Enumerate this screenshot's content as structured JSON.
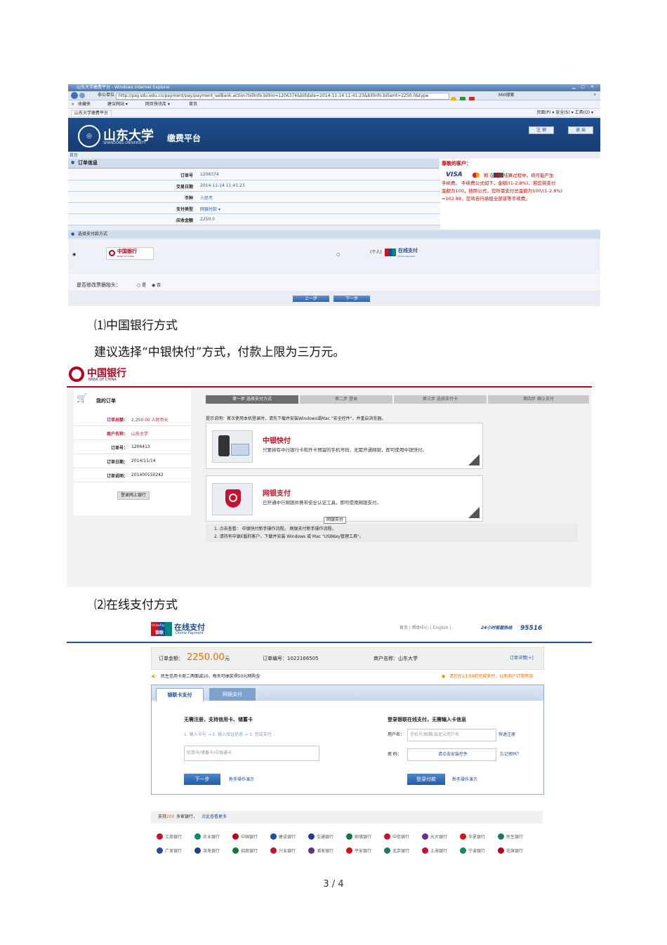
{
  "shot1": {
    "ie_title": "山东大学缴费平台 - Windows Internet Explorer",
    "url": "http://pay.sdu.edu.cn/payment/pay/payment_selBank.action?billInfo.billno=1206374&billdate=2014-11-14 11:41:23&billInfo.billamt=2250.0&type",
    "fav_label": "收藏夹",
    "fav_items": [
      "建议网站 ▾",
      "网页快讯库 ▾",
      "首页"
    ],
    "tab_label": "山东大学缴费平台",
    "toolbar_right": "页面(P) ▾  安全(S) ▾  工具(O) ▾",
    "search": "360搜索",
    "uni_name": "山东大学",
    "uni_en": "SHANDONG UNIVERSITY",
    "platform": "缴费平台",
    "btn_login": "注 销",
    "btn_exit": "退 出",
    "home_link": "首页",
    "order_head": "订单信息",
    "order_rows": [
      {
        "label": "订单号",
        "value": "1206374"
      },
      {
        "label": "交易日期",
        "value": "2014-11-14 11:41:23"
      },
      {
        "label": "币种",
        "value": "人民币"
      },
      {
        "label": "支付类型",
        "value": "网银付款 ▾"
      },
      {
        "label": "应收金额",
        "value": "2250.0"
      }
    ],
    "notice_head": "尊敬的客户：",
    "notice_brands": "VISA",
    "notice_text": [
      "和   在支付结算过程中，将可能产生",
      "手续费。 手续费公式如下，金额/(1-2.8%)，若您将支付",
      "金额为100，按照公式，您所需支付总金额为100/(1-2.8%)",
      "=102.88，您将自行承担全部该等手续费。"
    ],
    "select_label": "选择支付款方式",
    "boc_logo": "中国银行",
    "boc_logo_en": "BANK OF CHINA",
    "unionpay_label": "(个人)",
    "unionpay_logo": "在线支付",
    "unionpay_sub": "Online Payment",
    "modify_q": "是否修改票据抬头：",
    "opt_yes": "是",
    "opt_no": "否",
    "btn_prev": "上一步",
    "btn_next": "下一步"
  },
  "para1": "⑴中国银行方式",
  "para2": "建议选择“中银快付”方式，付款上限为三万元。",
  "shot2": {
    "logo": "中国银行",
    "logo_en": "BANK OF CHINA",
    "my_order": "我的订单",
    "rows": [
      {
        "label": "订单总额：",
        "value": "2,250.00 人民币元",
        "red": true
      },
      {
        "label": "商户名称：",
        "value": "山东大学",
        "red": true
      },
      {
        "label": "订单号：",
        "value": "1206413",
        "red": false
      },
      {
        "label": "订单日期：",
        "value": "2014/11/14",
        "red": false
      },
      {
        "label": "订单说明：",
        "value": "201400150242",
        "red": false
      }
    ],
    "login_btn": "登录网上银行",
    "steps": [
      "第一步 选择支付方式",
      "第二步 登录",
      "第三步 选择支付卡",
      "第四步 确认支付"
    ],
    "hint": "提示说明：首次使用本机登录时，请先下载并安装Windows或Mac \"安全控件\"，并重启浏览器。",
    "opt1_title": "中银快付",
    "opt1_desc": "只要持有中行银行卡和开卡预留的手机号码，无需开通网银，即可使用中银快付。",
    "opt2_title": "网银支付",
    "opt2_desc": "已开通中行网银并携带安全认证工具，即可使用网银支付。",
    "tooltip": "网银支付",
    "note1": "1. 点击查看：  中银快付新手操作流程。   网银支付新手操作流程。",
    "note2": "2. 请持有中银E盾的客户，下载并安装  Windows  或  Mac  \"USBKey管理工具\"。"
  },
  "para3": "⑵在线支付方式",
  "shot3": {
    "logo_top": "UnionPay",
    "logo_bottom": "银联",
    "brand": "在线支付",
    "brand_en": "Online Payment",
    "top_links": "首页 | 帮助中心 | English |",
    "hotline_label": "24小时客服热线",
    "hotline": "95516",
    "amount_label": "订单金额：",
    "amount": "2250.00",
    "amount_unit": "元",
    "order_no": "订单编号：1022166505",
    "merchant": "商户名称：山东大学",
    "order_detail": "订单详情[+]",
    "promo": "民生信用卡周二两面减10，每天可抽奖得50元网购金",
    "deadline": "请您在13:59前完成支付，以免商户订单失效",
    "tab1": "银联卡支付",
    "tab2": "网银支付",
    "left_title": "无需注册，支持信用卡、储蓄卡",
    "left_steps": "1. 输入卡号  →  2. 输入验证信息  →  3. 完成支付",
    "card_placeholder": "信用卡/储蓄卡/中银通卡",
    "next_btn": "下一步",
    "guide": "新手操作演示",
    "right_title": "登录银联在线支付，无需输入卡信息",
    "user_label": "用户名：",
    "user_placeholder": "手机号/邮箱/自定义用户名",
    "register": "快速注册",
    "pwd_label": "密    码：",
    "pwd_placeholder": "请点击安装控件",
    "forgot": "忘记密码？",
    "login_btn": "登录付款",
    "guide2": "新手操作演示",
    "support_prefix": "支持",
    "support_count": "200",
    "support_suffix": "多家银行，",
    "support_link": "点此查看更多",
    "banks_row1": [
      "工商银行",
      "农业银行",
      "中国银行",
      "建设银行",
      "交通银行",
      "邮储银行",
      "中信银行",
      "光大银行",
      "华夏银行",
      "民生银行"
    ],
    "banks_row2": [
      "广发银行",
      "深发银行",
      "招商银行",
      "兴业银行",
      "浦发银行",
      "平安银行",
      "北京银行",
      "上海银行",
      "宁波银行",
      "花旗银行"
    ],
    "bank_colors": [
      "#c8102e",
      "#008f5d",
      "#b8001f",
      "#1f4f9a",
      "#1c3f8f",
      "#0a7a3d",
      "#c8102e",
      "#6a2c8f",
      "#d0121b",
      "#1a7a5a"
    ]
  },
  "page_number": "3 / 4"
}
